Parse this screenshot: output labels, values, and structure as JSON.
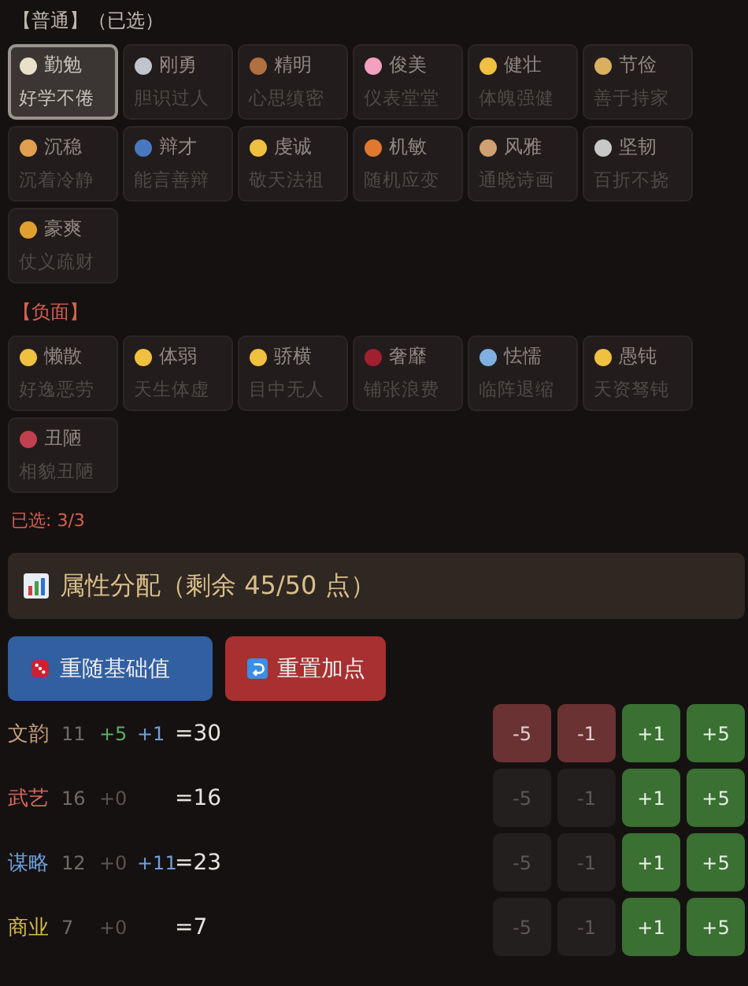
{
  "normal_section": {
    "title": "【普通】（已选）",
    "traits": [
      {
        "name": "勤勉",
        "desc": "好学不倦",
        "selected": true
      },
      {
        "name": "刚勇",
        "desc": "胆识过人",
        "selected": false
      },
      {
        "name": "精明",
        "desc": "心思缜密",
        "selected": false
      },
      {
        "name": "俊美",
        "desc": "仪表堂堂",
        "selected": false
      },
      {
        "name": "健壮",
        "desc": "体魄强健",
        "selected": false
      },
      {
        "name": "节俭",
        "desc": "善于持家",
        "selected": false
      },
      {
        "name": "沉稳",
        "desc": "沉着冷静",
        "selected": false
      },
      {
        "name": "辩才",
        "desc": "能言善辩",
        "selected": false
      },
      {
        "name": "虔诚",
        "desc": "敬天法祖",
        "selected": false
      },
      {
        "name": "机敏",
        "desc": "随机应变",
        "selected": false
      },
      {
        "name": "风雅",
        "desc": "通晓诗画",
        "selected": false
      },
      {
        "name": "坚韧",
        "desc": "百折不挠",
        "selected": false
      },
      {
        "name": "豪爽",
        "desc": "仗义疏财",
        "selected": false
      }
    ]
  },
  "negative_section": {
    "title": "【负面】",
    "traits": [
      {
        "name": "懒散",
        "desc": "好逸恶劳",
        "selected": false
      },
      {
        "name": "体弱",
        "desc": "天生体虚",
        "selected": false
      },
      {
        "name": "骄横",
        "desc": "目中无人",
        "selected": false
      },
      {
        "name": "奢靡",
        "desc": "铺张浪费",
        "selected": false
      },
      {
        "name": "怯懦",
        "desc": "临阵退缩",
        "selected": false
      },
      {
        "name": "愚钝",
        "desc": "天资驽钝",
        "selected": false
      },
      {
        "name": "丑陋",
        "desc": "相貌丑陋",
        "selected": false
      }
    ]
  },
  "selected_count": "已选: 3/3",
  "allocation_header": "属性分配（剩余 45/50 点）",
  "buttons": [
    {
      "label": "重随基础值",
      "kind": "reroll"
    },
    {
      "label": "重置加点",
      "kind": "reset"
    }
  ],
  "stats": [
    {
      "name": "文韵",
      "color": "#c9a27a",
      "base": "11",
      "bonus": "+5",
      "bonus_on": true,
      "extra": "+1",
      "total": "=30",
      "minus_disabled": false,
      "buttons": [
        "-5",
        "-1",
        "+1",
        "+5"
      ]
    },
    {
      "name": "武艺",
      "color": "#d9675a",
      "base": "16",
      "bonus": "+0",
      "bonus_on": false,
      "total": "=16",
      "minus_disabled": true,
      "buttons": [
        "-5",
        "-1",
        "+1",
        "+5"
      ]
    },
    {
      "name": "谋略",
      "color": "#6f9fd8",
      "base": "12",
      "bonus": "+0",
      "bonus_on": false,
      "extra": "+11",
      "total": "=23",
      "minus_disabled": true,
      "buttons": [
        "-5",
        "-1",
        "+1",
        "+5"
      ]
    },
    {
      "name": "商业",
      "color": "#d4b84a",
      "base": "7",
      "bonus": "+0",
      "bonus_on": false,
      "total": "=7",
      "minus_disabled": true,
      "buttons": [
        "-5",
        "-1",
        "+1",
        "+5"
      ]
    }
  ]
}
